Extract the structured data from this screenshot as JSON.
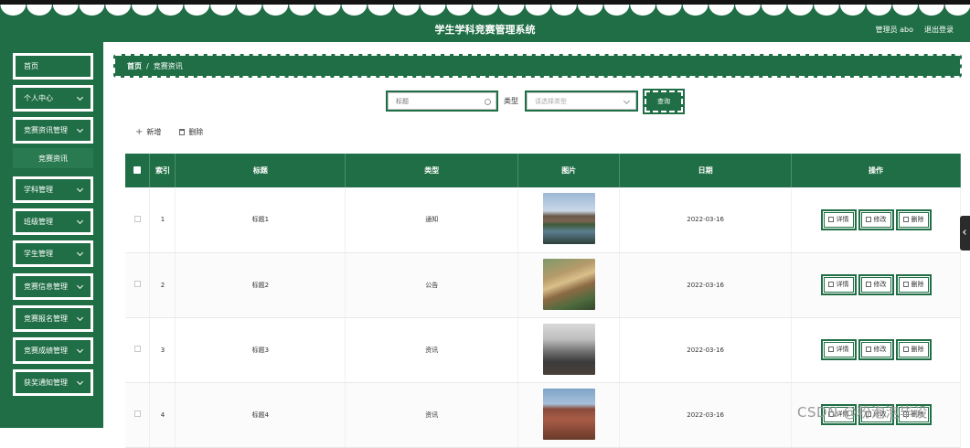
{
  "header": {
    "title": "学生学科竞赛管理系统",
    "user": "管理员 abo",
    "logout": "退出登录"
  },
  "sidebar": {
    "items": [
      {
        "label": "首页",
        "has_arrow": false
      },
      {
        "label": "个人中心",
        "has_arrow": true
      },
      {
        "label": "竞赛资讯管理",
        "has_arrow": true
      },
      {
        "label": "学科管理",
        "has_arrow": true
      },
      {
        "label": "班级管理",
        "has_arrow": true
      },
      {
        "label": "学生管理",
        "has_arrow": true
      },
      {
        "label": "竞赛信息管理",
        "has_arrow": true
      },
      {
        "label": "竞赛报名管理",
        "has_arrow": true
      },
      {
        "label": "竞赛成绩管理",
        "has_arrow": true
      },
      {
        "label": "获奖通知管理",
        "has_arrow": true
      }
    ],
    "sub_item": "竞赛资讯"
  },
  "breadcrumb": {
    "home": "首页",
    "separator": "/",
    "current": "竞赛资讯"
  },
  "search": {
    "title_placeholder": "标题",
    "type_label": "类型",
    "type_placeholder": "请选择类型",
    "query_button": "查询"
  },
  "actions": {
    "add": "新增",
    "delete": "删除"
  },
  "table": {
    "headers": {
      "index": "索引",
      "title": "标题",
      "type": "类型",
      "image": "图片",
      "date": "日期",
      "ops": "操作"
    },
    "rows": [
      {
        "index": "1",
        "title": "标题1",
        "type": "通知",
        "date": "2022-03-16",
        "image_icon": "lake-building-photo-icon"
      },
      {
        "index": "2",
        "title": "标题2",
        "type": "公告",
        "date": "2022-03-16",
        "image_icon": "campus-aerial-photo-icon"
      },
      {
        "index": "3",
        "title": "标题3",
        "type": "资讯",
        "date": "2022-03-16",
        "image_icon": "lecture-hall-photo-icon"
      },
      {
        "index": "4",
        "title": "标题4",
        "type": "资讯",
        "date": "2022-03-16",
        "image_icon": "clock-tower-photo-icon"
      }
    ],
    "op_labels": {
      "detail": "详情",
      "edit": "修改",
      "delete": "删除"
    }
  },
  "watermark": "CSDN @粉泡泡毕设",
  "colors": {
    "primary": "#1f6e45",
    "header_text": "#ffffff"
  }
}
